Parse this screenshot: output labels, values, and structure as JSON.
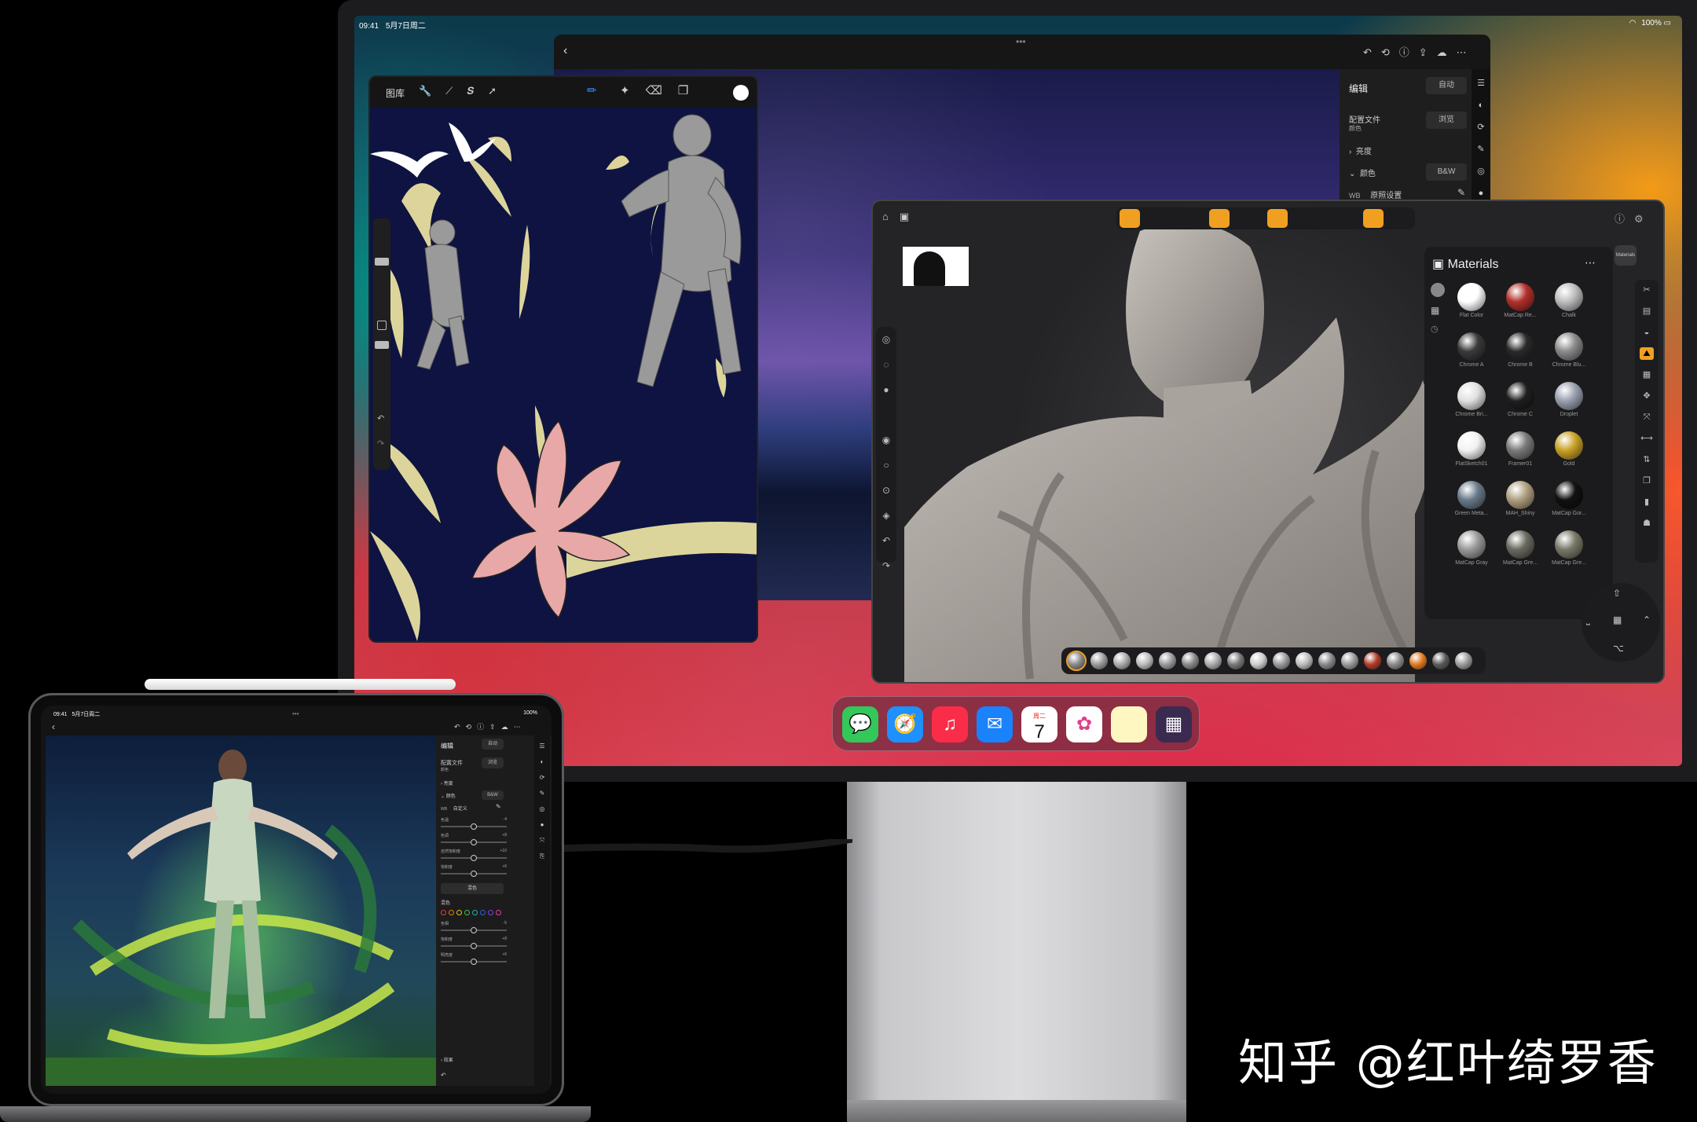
{
  "display": {
    "status_time": "09:41",
    "status_date": "5月7日周二",
    "status_battery": "100%",
    "dock_apps": [
      {
        "icon": "messages-icon",
        "glyph": "💬",
        "color": "#34c759"
      },
      {
        "icon": "safari-icon",
        "glyph": "🧭",
        "color": "#1e90ff"
      },
      {
        "icon": "music-icon",
        "glyph": "♫",
        "color": "#fa2d48"
      },
      {
        "icon": "mail-icon",
        "glyph": "✉",
        "color": "#1a82fb"
      },
      {
        "icon": "calendar-icon",
        "glyph": "7",
        "color": "#ffffff"
      },
      {
        "icon": "photos-icon",
        "glyph": "✿",
        "color": "#ffffff"
      },
      {
        "icon": "notes-icon",
        "glyph": "",
        "color": "#fff7c2"
      },
      {
        "icon": "app-library-icon",
        "glyph": "▦",
        "color": "#3a2a50"
      }
    ],
    "calendar_weekday": "周二",
    "calendar_day": "7"
  },
  "lightroom": {
    "panel_title": "编辑",
    "auto_label": "自动",
    "profile_label": "配置文件",
    "profile_value": "颜色",
    "browse_label": "浏览",
    "light_label": "亮度",
    "color_label": "颜色",
    "bw_label": "B&W",
    "wb_label": "WB",
    "wb_value": "原照设置"
  },
  "procreate": {
    "gallery_label": "图库"
  },
  "nomad": {
    "materials_title": "Materials",
    "materials_tab": "Materials",
    "materials": [
      {
        "name": "Flat Color",
        "color": "#ffffff"
      },
      {
        "name": "MatCap Re...",
        "color": "#b0302a"
      },
      {
        "name": "Chalk",
        "color": "#bdbdbd"
      },
      {
        "name": "Chrome A",
        "color": "#3a3a3a"
      },
      {
        "name": "Chrome B",
        "color": "#2a2a2a"
      },
      {
        "name": "Chrome Blu...",
        "color": "#8a8a8a"
      },
      {
        "name": "Chrome Bri...",
        "color": "#e0e0e0"
      },
      {
        "name": "Chrome C",
        "color": "#1f1f1f"
      },
      {
        "name": "Droplet",
        "color": "#9aa0b0"
      },
      {
        "name": "FlatSketch01",
        "color": "#f2f2f2"
      },
      {
        "name": "Framer01",
        "color": "#7a7a7a"
      },
      {
        "name": "Gold",
        "color": "#c9a227"
      },
      {
        "name": "Green Meta...",
        "color": "#6a7a8a"
      },
      {
        "name": "MAH_Shiny",
        "color": "#b0a080"
      },
      {
        "name": "MatCap Gor...",
        "color": "#111111"
      },
      {
        "name": "MatCap Gray",
        "color": "#9a9a9a"
      },
      {
        "name": "MatCap Gre...",
        "color": "#6a6a60"
      },
      {
        "name": "MatCap Gre...",
        "color": "#7a7a6a"
      }
    ],
    "bottom_swatches": [
      "#8a8a8a",
      "#9a9a9a",
      "#aaaaaa",
      "#bbbbbb",
      "#999",
      "#888",
      "#aaa",
      "#777",
      "#ccc",
      "#999",
      "#bbb",
      "#888",
      "#999",
      "#b03a2a",
      "#8a8a8a",
      "#e07a20",
      "#5a5a5a",
      "#9a9a9a"
    ]
  },
  "ipad": {
    "status_time": "09:41",
    "status_date": "5月7日周二",
    "status_battery": "100%",
    "panel_title": "编辑",
    "auto_label": "自动",
    "profile_label": "配置文件",
    "profile_value": "颜色",
    "browse_label": "浏览",
    "light_label": "亮度",
    "color_label": "颜色",
    "bw_label": "B&W",
    "wb_label": "WB",
    "wb_value": "自定义",
    "sliders": [
      {
        "label": "色温",
        "value": "-4"
      },
      {
        "label": "色调",
        "value": "+8"
      },
      {
        "label": "自然饱和度",
        "value": "+10"
      },
      {
        "label": "饱和度",
        "value": "+6"
      }
    ],
    "mix_label": "混色",
    "mix_section": "混色",
    "mix_dot_colors": [
      "#e04040",
      "#e07a20",
      "#e0c020",
      "#40c040",
      "#20b0b0",
      "#3060e0",
      "#8040e0",
      "#e040a0"
    ],
    "mix_sliders": [
      {
        "label": "色相",
        "value": "-5"
      },
      {
        "label": "饱和度",
        "value": "+8"
      },
      {
        "label": "明亮度",
        "value": "+6"
      }
    ],
    "effects_label": "效果"
  },
  "watermark": "知乎 @红叶绮罗香"
}
